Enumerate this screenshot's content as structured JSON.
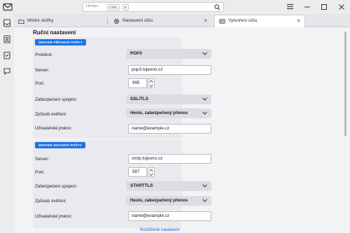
{
  "search": {
    "placeholder": "Hledat...",
    "kbd_ctrl": "CTRL",
    "kbd_k": "K"
  },
  "tabs": [
    {
      "label": "Místní složky",
      "icon": "folder-icon"
    },
    {
      "label": "Nastavení účtu",
      "icon": "gear-icon",
      "close": "×"
    },
    {
      "label": "Vytvoření účtu",
      "icon": "account-setup-icon",
      "close": "×"
    }
  ],
  "page": {
    "section_title": "Ruční nastavení",
    "advanced_link": "Rozšířené nastavení"
  },
  "incoming": {
    "badge": "SERVER PŘÍCHOZÍ POŠTY",
    "protocol_label": "Protokol:",
    "protocol_value": "POP3",
    "server_label": "Server:",
    "server_value": "pop3.tojeono.cz",
    "port_label": "Port:",
    "port_value": "995",
    "security_label": "Zabezpečení spojení:",
    "security_value": "SSL/TLS",
    "auth_label": "Způsob ověření:",
    "auth_value": "Heslo, zabezpečený přenos",
    "user_label": "Uživatelské jméno:",
    "user_value": "name@example.cz"
  },
  "outgoing": {
    "badge": "SERVER ODCHOZÍ POŠTY",
    "server_label": "Server:",
    "server_value": "smtp.tojeono.cz",
    "port_label": "Port:",
    "port_value": "587",
    "security_label": "Zabezpečení spojení:",
    "security_value": "STARTTLS",
    "auth_label": "Způsob ověření:",
    "auth_value": "Heslo, zabezpečený přenos",
    "user_label": "Uživatelské jméno:",
    "user_value": "name@example.cz"
  },
  "colors": {
    "accent": "#1a73e8",
    "link": "#1a5fc8"
  }
}
